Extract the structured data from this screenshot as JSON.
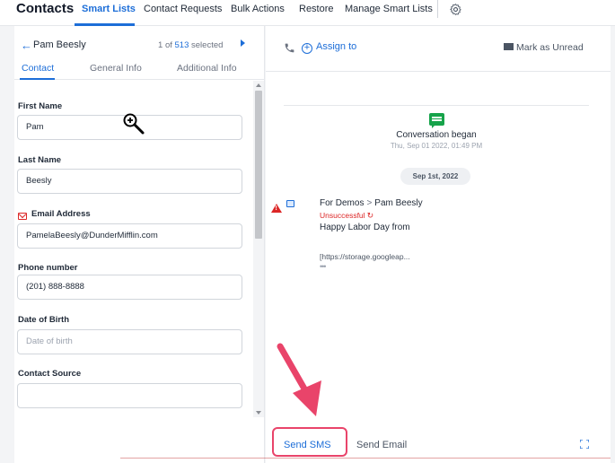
{
  "nav": {
    "brand": "Contacts",
    "tabs": [
      "Smart Lists",
      "Contact Requests",
      "Bulk Actions",
      "Restore",
      "Manage Smart Lists"
    ],
    "active_tab": "Smart Lists",
    "settings_icon": "gear-icon"
  },
  "contact": {
    "name": "Pam Beesly",
    "pager_current": "1",
    "pager_of": "of",
    "pager_total": "513",
    "pager_selected": "selected",
    "tabs": [
      "Contact",
      "General Info",
      "Additional Info"
    ],
    "active_tab": "Contact"
  },
  "form": {
    "fields": [
      {
        "label": "First Name",
        "value": "Pam"
      },
      {
        "label": "Last Name",
        "value": "Beesly"
      },
      {
        "label": "Email Address",
        "value": "PamelaBeesly@DunderMifflin.com"
      },
      {
        "label": "Phone number",
        "value": "(201) 888-8888"
      },
      {
        "label": "Date of Birth",
        "placeholder": "Date of birth"
      },
      {
        "label": "Contact Source",
        "value": ""
      }
    ]
  },
  "conversation": {
    "assign_label": "Assign to",
    "mark_unread_label": "Mark as Unread",
    "began_label": "Conversation began",
    "began_time": "Thu, Sep 01 2022, 01:49 PM",
    "date_pill": "Sep 1st, 2022",
    "message": {
      "from": "For Demos",
      "separator": ">",
      "to": "Pam Beesly",
      "status": "Unsuccessful",
      "subject": "Happy Labor Day from",
      "body": "[https://storage.googleap...",
      "more": "•••"
    }
  },
  "composer": {
    "tabs": [
      "Send SMS",
      "Send Email"
    ],
    "active_tab": "Send SMS"
  },
  "colors": {
    "accent": "#1d6ed8",
    "error": "#dc2626",
    "success": "#16a34a",
    "annotation": "#e9446a"
  }
}
